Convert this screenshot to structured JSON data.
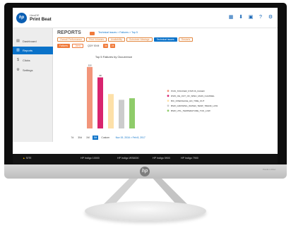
{
  "app": {
    "brand_small": "HewDE",
    "brand_name": "Print Beat",
    "logo_text": "hp",
    "top_icons": [
      "grid-icon",
      "download-icon",
      "calendar-icon",
      "help-icon",
      "settings-icon"
    ]
  },
  "sidebar": {
    "items": [
      {
        "label": "Dashboard",
        "icon": "dashboard-icon",
        "active": false
      },
      {
        "label": "Reports",
        "icon": "reports-icon",
        "active": true
      },
      {
        "label": "Clicks",
        "icon": "dollar-icon",
        "active": false
      },
      {
        "label": "Settings",
        "icon": "gear-icon",
        "active": false
      }
    ]
  },
  "page": {
    "title": "REPORTS",
    "breadcrumb": "Technical issues > Failures > Top 5"
  },
  "tabs": [
    {
      "label": "Overall Performance",
      "active": false
    },
    {
      "label": "Print Volumes",
      "active": false
    },
    {
      "label": "Availability",
      "active": false
    },
    {
      "label": "Substrate Wastage",
      "active": false
    },
    {
      "label": "Technical Issues",
      "active": true
    },
    {
      "label": "Restarts",
      "active": false
    }
  ],
  "filters": {
    "primary": "Failures",
    "secondary": "Jams",
    "period": "Q3/Y 00:M",
    "toggle_a": "3d",
    "toggle_b": "24"
  },
  "chart_data": {
    "type": "bar",
    "title": "Top 5 Failures by Occurrence",
    "categories": [
      "PCW_STACKER_STATUS_FAILED",
      "DSW_OE_OUT_OF_SPEC_MAIN_CHANNEL",
      "BIC_DISENGAGE_HD_TIME_OUT",
      "BSW_GROWING_WATER_TEMP_TREND_LOW",
      "BSW_UTIL_TEMPERATURE_TOO_LOW"
    ],
    "values": [
      118,
      98,
      66,
      55,
      58
    ],
    "value_labels": [
      "118",
      "98",
      "",
      "",
      ""
    ],
    "colors": [
      "#f2957a",
      "#d8246e",
      "#fde0a8",
      "#cccccc",
      "#8fcc6a"
    ],
    "ylim": [
      0,
      130
    ],
    "grid": false,
    "legend": "right"
  },
  "range": {
    "buttons": [
      {
        "label": "7d",
        "active": false
      },
      {
        "label": "30d",
        "active": false
      },
      {
        "label": "1M",
        "active": false
      },
      {
        "label": "3M",
        "active": true
      },
      {
        "label": "Custom",
        "active": false
      }
    ],
    "dates": "Nov 19, 2016 > Feb 8, 2017"
  },
  "printers": {
    "status": "SITE",
    "items": [
      "HP Indigo 10000",
      "HP Indigo WS6000",
      "HP Indigo 5900",
      "HP Indigo 7900"
    ]
  },
  "monitor": {
    "badge": "hp",
    "label": "Pavilion 23xw"
  }
}
